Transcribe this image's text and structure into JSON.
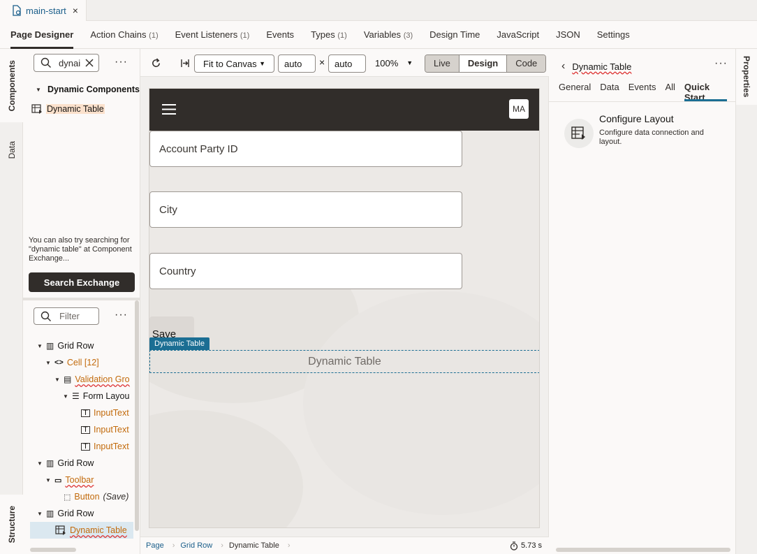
{
  "file_tab": {
    "name": "main-start",
    "close": "×"
  },
  "main_tabs": [
    {
      "label": "Page Designer",
      "count": ""
    },
    {
      "label": "Action Chains",
      "count": "(1)"
    },
    {
      "label": "Event Listeners",
      "count": "(1)"
    },
    {
      "label": "Events",
      "count": ""
    },
    {
      "label": "Types",
      "count": "(1)"
    },
    {
      "label": "Variables",
      "count": "(3)"
    },
    {
      "label": "Design Time",
      "count": ""
    },
    {
      "label": "JavaScript",
      "count": ""
    },
    {
      "label": "JSON",
      "count": ""
    },
    {
      "label": "Settings",
      "count": ""
    }
  ],
  "left_rail": {
    "components": "Components",
    "data": "Data",
    "structure": "Structure"
  },
  "components_panel": {
    "search_value": "dynai",
    "group_label": "Dynamic Components",
    "result_item": "Dynamic Table",
    "hint": "You can also try searching for \"dynamic table\" at Component Exchange...",
    "search_exchange": "Search Exchange",
    "more": "···"
  },
  "structure_panel": {
    "filter_placeholder": "Filter",
    "more": "···",
    "tree": [
      {
        "label": "Grid Row",
        "extra": ""
      },
      {
        "label": "Cell [12]",
        "extra": ""
      },
      {
        "label": "Validation Gro",
        "extra": ""
      },
      {
        "label": "Form Layou",
        "extra": ""
      },
      {
        "label": "InputText",
        "extra": ""
      },
      {
        "label": "InputText",
        "extra": ""
      },
      {
        "label": "InputText",
        "extra": ""
      },
      {
        "label": "Grid Row",
        "extra": ""
      },
      {
        "label": "Toolbar",
        "extra": ""
      },
      {
        "label": "Button",
        "extra": "(Save)"
      },
      {
        "label": "Grid Row",
        "extra": ""
      },
      {
        "label": "Dynamic Table",
        "extra": ""
      }
    ]
  },
  "toolbar": {
    "fit": "Fit to Canvas",
    "width": "auto",
    "times": "×",
    "height": "auto",
    "zoom": "100%",
    "modes": [
      "Live",
      "Design",
      "Code"
    ]
  },
  "canvas": {
    "avatar": "MA",
    "fields": [
      "Account Party ID",
      "City",
      "Country"
    ],
    "save_label": "Save",
    "badge": "Dynamic Table",
    "table_label": "Dynamic Table"
  },
  "breadcrumb": {
    "items": [
      "Page",
      "Grid Row",
      "Dynamic Table"
    ],
    "timer": "5.73 s"
  },
  "properties": {
    "title": "Dynamic Table",
    "more": "···",
    "tabs": [
      "General",
      "Data",
      "Events",
      "All",
      "Quick Start"
    ],
    "card_title": "Configure Layout",
    "card_desc": "Configure data connection and layout.",
    "rail_label": "Properties"
  },
  "colors": {
    "accent": "#1b6e93",
    "orange": "#c26a0b",
    "dark": "#312d2a"
  }
}
